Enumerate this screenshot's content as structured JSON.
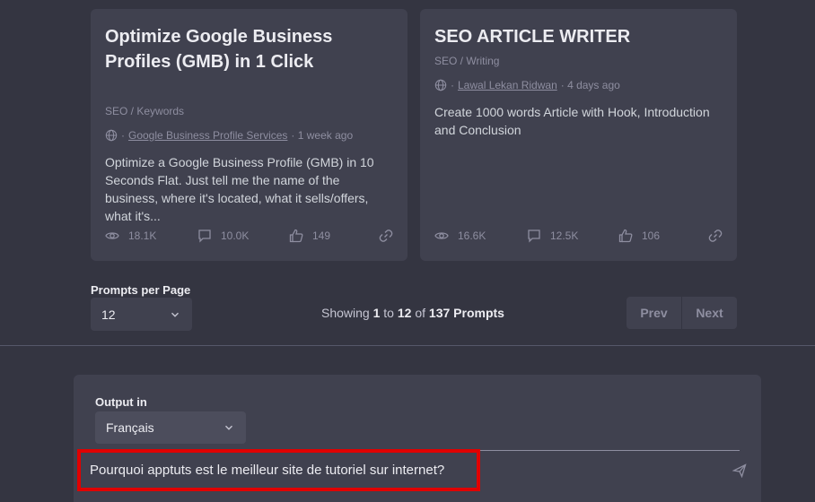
{
  "cards": [
    {
      "title": "Optimize Google Business Profiles (GMB) in 1 Click",
      "category": "SEO / Keywords",
      "author": "Google Business Profile Services",
      "time": "· 1 week ago",
      "description": "Optimize a Google Business Profile (GMB) in 10 Seconds Flat. Just tell me the name of the business, where it's located, what it sells/offers, what it's...",
      "views": "18.1K",
      "comments": "10.0K",
      "likes": "149"
    },
    {
      "title": "SEO ARTICLE WRITER",
      "category": "SEO / Writing",
      "author": "Lawal Lekan Ridwan",
      "time": "· 4 days ago",
      "description": "Create 1000 words Article with Hook, Introduction and Conclusion",
      "views": "16.6K",
      "comments": "12.5K",
      "likes": "106"
    }
  ],
  "pagination": {
    "per_page_label": "Prompts per Page",
    "per_page_value": "12",
    "showing_prefix": "Showing",
    "from": "1",
    "to_word": "to",
    "to": "12",
    "of_word": "of",
    "total": "137 Prompts",
    "prev_label": "Prev",
    "next_label": "Next"
  },
  "output": {
    "label": "Output in",
    "language": "Français"
  },
  "prompt": {
    "value": "Pourquoi apptuts est le meilleur site de tutoriel sur internet?"
  },
  "colors": {
    "background": "#343541",
    "panel": "#40414f",
    "highlight_border": "#e00000"
  }
}
